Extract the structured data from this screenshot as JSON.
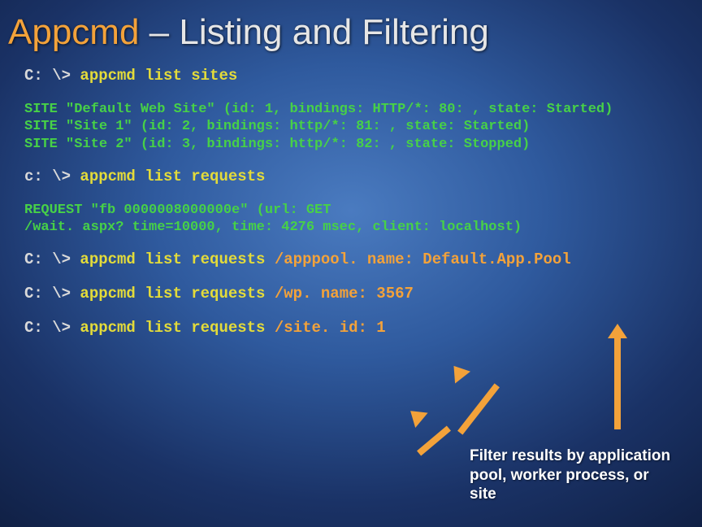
{
  "title": {
    "part1": "Appcmd",
    "dash": " – ",
    "part2": "Listing and Filtering"
  },
  "lines": {
    "p1": "C: \\> ",
    "c1": "appcmd list sites",
    "out1": "SITE \"Default Web Site\" (id: 1, bindings: HTTP/*: 80: , state: Started)",
    "out2": "SITE \"Site 1\" (id: 2, bindings: http/*: 81: , state: Started)",
    "out3": "SITE \"Site 2\" (id: 3, bindings: http/*: 82: , state: Stopped)",
    "p2": "c: \\> ",
    "c2": "appcmd list requests",
    "out4a": "REQUEST \"fb 0000008000000e\" (url: GET",
    "out4b": "/wait. aspx? time=10000, time: 4276 msec, client: localhost)",
    "p3": "C: \\> ",
    "c3": "appcmd list requests ",
    "a3": "/apppool. name: Default.App.Pool",
    "p4": "C: \\> ",
    "c4": "appcmd list requests ",
    "a4": "/wp. name: 3567",
    "p5": "C: \\> ",
    "c5": "appcmd list requests ",
    "a5": "/site. id: 1"
  },
  "note": "Filter results by application pool, worker process, or site"
}
